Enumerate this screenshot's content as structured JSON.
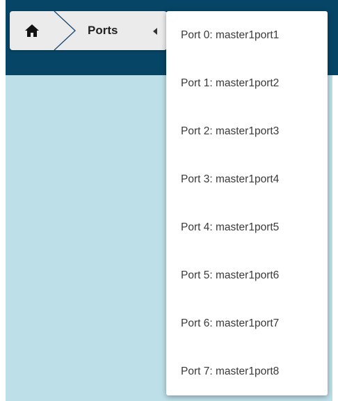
{
  "breadcrumb": {
    "home_icon": "home-icon",
    "separator_icon": "chevron-right-icon",
    "current": "Ports",
    "caret_icon": "caret-left-icon"
  },
  "menu": {
    "items": [
      "Port 0: master1port1",
      "Port 1: master1port2",
      "Port 2: master1port3",
      "Port 3: master1port4",
      "Port 4: master1port5",
      "Port 5: master1port6",
      "Port 6: master1port7",
      "Port 7: master1port8"
    ]
  },
  "colors": {
    "topbar": "#064566",
    "content": "#bddfe8",
    "breadcrumb_bg": "#ebebeb",
    "chevron": "#1f4d73"
  }
}
